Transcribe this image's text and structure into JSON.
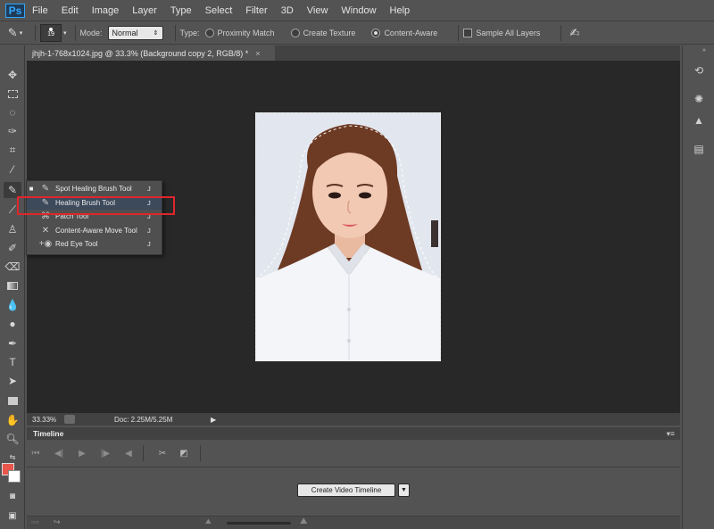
{
  "app": {
    "logo": "Ps"
  },
  "menu": [
    "File",
    "Edit",
    "Image",
    "Layer",
    "Type",
    "Select",
    "Filter",
    "3D",
    "View",
    "Window",
    "Help"
  ],
  "options": {
    "brush_size": "19",
    "mode_label": "Mode:",
    "mode_value": "Normal",
    "type_label": "Type:",
    "types": [
      "Proximity Match",
      "Create Texture",
      "Content-Aware"
    ],
    "selected_type": "Content-Aware",
    "sample_all_layers": "Sample All Layers"
  },
  "document": {
    "tab_title": "jhjh-1-768x1024.jpg @ 33.3% (Background copy 2, RGB/8) *",
    "close": "×"
  },
  "status": {
    "zoom": "33.33%",
    "doc": "Doc: 2.25M/5.25M"
  },
  "timeline": {
    "title": "Timeline",
    "create_button": "Create Video Timeline"
  },
  "flyout": {
    "items": [
      {
        "label": "Spot Healing Brush Tool",
        "key": "J",
        "icon": "spot-healing-brush-icon",
        "current": true
      },
      {
        "label": "Healing Brush Tool",
        "key": "J",
        "icon": "healing-brush-icon",
        "current": false
      },
      {
        "label": "Patch Tool",
        "key": "J",
        "icon": "patch-icon",
        "current": false
      },
      {
        "label": "Content-Aware Move Tool",
        "key": "J",
        "icon": "content-aware-move-icon",
        "current": false
      },
      {
        "label": "Red Eye Tool",
        "key": "J",
        "icon": "red-eye-icon",
        "current": false
      }
    ],
    "highlighted_index": 1
  },
  "colors": {
    "foreground": "#e8564c",
    "background": "#ffffff",
    "highlight_box": "#e0262b"
  }
}
